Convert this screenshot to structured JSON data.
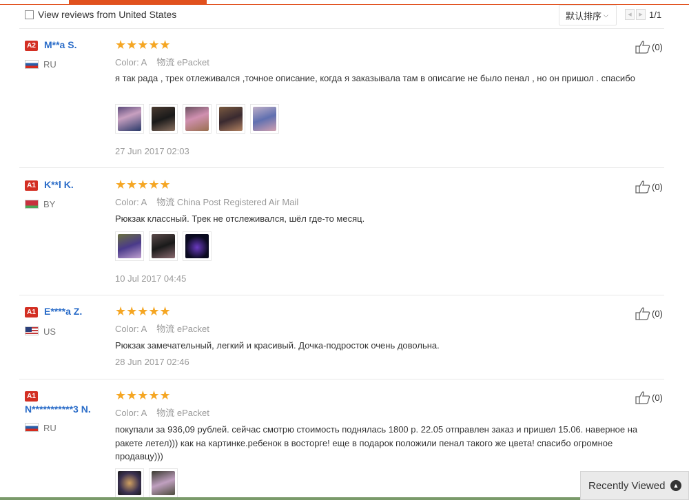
{
  "toolbar": {
    "filter_label": "View reviews from United States",
    "sort_label": "默认排序",
    "page_indicator": "1/1"
  },
  "reviews": [
    {
      "level": "A2",
      "name": "M**a S.",
      "country": "RU",
      "rating": 5,
      "color_label": "Color:",
      "color_value": "A",
      "ship_label": "物流",
      "ship_value": "ePacket",
      "text": "я так рада , трек отлеживался ,точное описание, когда я заказывала там в описагие не было пенал , но он пришол . спасибо",
      "date": "27 Jun 2017 02:03",
      "likes": "(0)",
      "photo_count": 5
    },
    {
      "level": "A1",
      "name": "K**l K.",
      "country": "BY",
      "rating": 5,
      "color_label": "Color:",
      "color_value": "A",
      "ship_label": "物流",
      "ship_value": "China Post Registered Air Mail",
      "text": "Рюкзак классный. Трек не отслеживался, шёл где-то месяц.",
      "date": "10 Jul 2017 04:45",
      "likes": "(0)",
      "photo_count": 3
    },
    {
      "level": "A1",
      "name": "E****a Z.",
      "country": "US",
      "rating": 5,
      "color_label": "Color:",
      "color_value": "A",
      "ship_label": "物流",
      "ship_value": "ePacket",
      "text": "Рюкзак замечательный, легкий и красивый. Дочка-подросток очень довольна.",
      "date": "28 Jun 2017 02:46",
      "likes": "(0)",
      "photo_count": 0
    },
    {
      "level": "A1",
      "name": "N***********3 N.",
      "country": "RU",
      "rating": 5,
      "color_label": "Color:",
      "color_value": "A",
      "ship_label": "物流",
      "ship_value": "ePacket",
      "text": "покупали за 936,09 рублей. сейчас смотрю стоимость поднялась 1800 р. 22.05 отправлен заказ и пришел 15.06. наверное на ракете летел))) как на картинке.ребенок в восторге! еще в подарок положили пенал такого же цвета! спасибо огромное продавцу)))",
      "likes": "(0)",
      "photo_count": 2
    }
  ],
  "stars_glyph": "★★★★★",
  "recently_viewed": "Recently Viewed",
  "colors": {
    "accent": "#e1511e",
    "name": "#2a6cc8",
    "star": "#f5a623",
    "level": "#d32f23"
  }
}
